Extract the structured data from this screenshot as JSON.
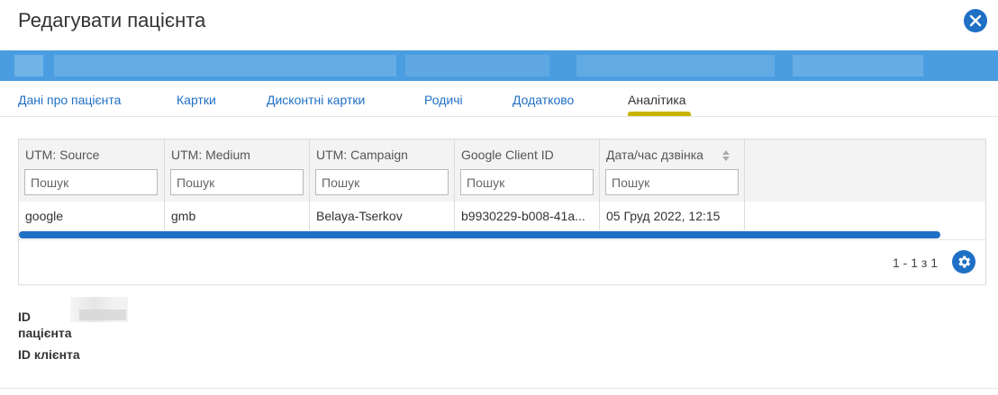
{
  "dialog": {
    "title": "Редагувати пацієнта"
  },
  "tabs": [
    {
      "label": "Дані про пацієнта"
    },
    {
      "label": "Картки"
    },
    {
      "label": "Дисконтні картки"
    },
    {
      "label": "Родичі"
    },
    {
      "label": "Додатково"
    },
    {
      "label": "Аналітика",
      "active": true
    }
  ],
  "grid": {
    "columns": [
      {
        "title": "UTM: Source"
      },
      {
        "title": "UTM: Medium"
      },
      {
        "title": "UTM: Campaign"
      },
      {
        "title": "Google Client ID"
      },
      {
        "title": "Дата/час дзвінка"
      }
    ],
    "filter_placeholder": "Пошук",
    "rows": [
      [
        "google",
        "gmb",
        "Belaya-Tserkov",
        "b9930229-b008-41a...",
        "05 Груд 2022, 12:15"
      ]
    ],
    "pager": "1 - 1 з 1"
  },
  "info": {
    "patient_id_label": "ID",
    "patient_id_label2": "пацієнта",
    "client_id_label": "ID клієнта"
  },
  "colors": {
    "accent": "#1f6fc5",
    "patient_bar": "#4a9de0",
    "tab_underline": "#c8b400"
  },
  "icons": {
    "close": "close-icon",
    "settings": "gear-icon",
    "sort": "sort-icon"
  }
}
